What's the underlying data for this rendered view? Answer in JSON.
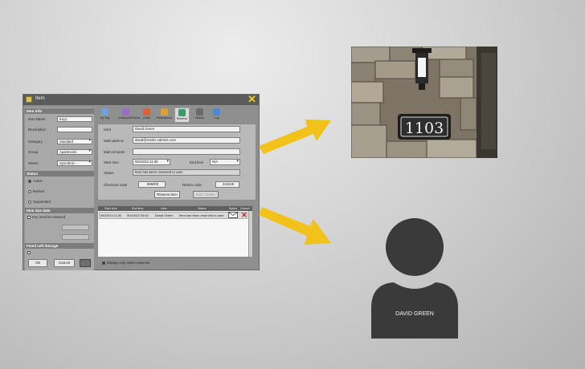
{
  "window": {
    "title": "Item",
    "left": {
      "item_info_header": "Item info",
      "item_name_label": "Item Name",
      "item_name_value": "Key1",
      "description_label": "Description",
      "description_value": "",
      "category_label": "Category",
      "category_value": "Standard",
      "group_label": "Group",
      "group_value": "Apartments",
      "owner_label": "Owner",
      "owner_value": "SysAdmin - -",
      "status_header": "Status",
      "status_options": [
        "Active",
        "Retired",
        "Suspended"
      ],
      "item_due_date_header": "Item due date",
      "key_returned_label": "Key must be returned",
      "fixed_cell_storage_header": "Fixed cell Storage",
      "ok_label": "Ok",
      "cancel_label": "Cancel"
    },
    "tabs": [
      {
        "label": "My Tag",
        "color": "#6fa3d8"
      },
      {
        "label": "Checkout/Return",
        "color": "#9a6bc8"
      },
      {
        "label": "Limits",
        "color": "#d8643a"
      },
      {
        "label": "Restrictions",
        "color": "#e0a030"
      },
      {
        "label": "Reserve",
        "color": "#3a9a6a"
      },
      {
        "label": "History",
        "color": "#6a6a6a"
      },
      {
        "label": "Log",
        "color": "#4a8ad0"
      }
    ],
    "reserve": {
      "user_label": "User",
      "user_value": "David Green",
      "mail_address_label": "Mail address",
      "mail_address_value": "david@matrix-cabinet.com",
      "mail_reminder_label": "Mail reminder",
      "mail_reminder_value": "",
      "start_time_label": "Start time",
      "start_time_value": "05/23/23 11:30",
      "end_time_label": "End time",
      "end_time_value": "N/A",
      "status_label": "Status",
      "status_value": "Item has been reserved to user",
      "checkout_code_label": "Checkout code",
      "checkout_code_value": "986000",
      "return_code_label": "Return code",
      "return_code_value": "224245",
      "reserve_button": "Reserve item",
      "edit_button": "Edit / Delete"
    },
    "table": {
      "headers": [
        "Start time",
        "End time",
        "User",
        "Status",
        "Select",
        "Cancel"
      ],
      "rows": [
        {
          "start": "05/23/23 11:30",
          "end": "05/24/23 00:00",
          "user": "David Green",
          "status": "Item has been reserved to user"
        }
      ],
      "only_active_label": "Display only active reserves"
    }
  },
  "avatar": {
    "name": "DAVID GREEN"
  },
  "photo": {
    "house_number": "1103"
  },
  "colors": {
    "arrow": "#f2c21b",
    "avatar": "#3a3a3a",
    "window_close": "#f2d21a"
  }
}
